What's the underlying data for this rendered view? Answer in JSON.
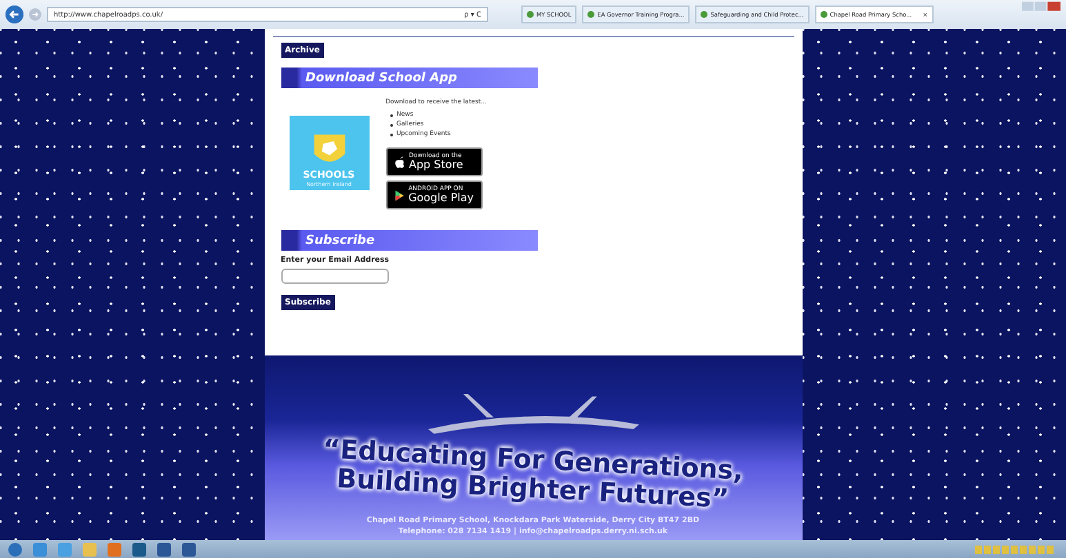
{
  "browser": {
    "address": "http://www.chapelroadps.co.uk/",
    "search_hint": "ρ ▾ C",
    "tabs": [
      {
        "label": "MY SCHOOL",
        "selected": false
      },
      {
        "label": "EA Governor Training Progra...",
        "selected": false
      },
      {
        "label": "Safeguarding and Child Protec...",
        "selected": false
      },
      {
        "label": "Chapel Road Primary Scho...",
        "selected": true,
        "close": "×"
      }
    ]
  },
  "page": {
    "archive_button": "Archive",
    "app_section": {
      "heading": "Download School App",
      "intro": "Download to receive the latest...",
      "items": [
        "News",
        "Galleries",
        "Upcoming Events"
      ],
      "logo_text": "SCHOOLS",
      "logo_subtext": "Northern Ireland",
      "badges": [
        {
          "kind": "apple",
          "small": "Download on the",
          "big": "App Store"
        },
        {
          "kind": "google",
          "small": "ANDROID APP ON",
          "big": "Google Play"
        }
      ]
    },
    "subscribe": {
      "heading": "Subscribe",
      "label": "Enter your Email Address",
      "button": "Subscribe"
    },
    "footer": {
      "slogan_1": "“Educating For Generations,",
      "slogan_2": "Building Brighter Futures”",
      "address": "Chapel Road Primary School, Knockdara Park Waterside, Derry City BT47 2BD",
      "contact": "Telephone: 028 7134 1419 | info@chapelroadps.derry.ni.sch.uk"
    }
  },
  "taskbar": {
    "apps": [
      {
        "kind": "start"
      },
      {
        "kind": "people"
      },
      {
        "kind": "ie"
      },
      {
        "kind": "folder"
      },
      {
        "kind": "outlook"
      },
      {
        "kind": "sims"
      },
      {
        "kind": "word"
      },
      {
        "kind": "word"
      }
    ]
  }
}
